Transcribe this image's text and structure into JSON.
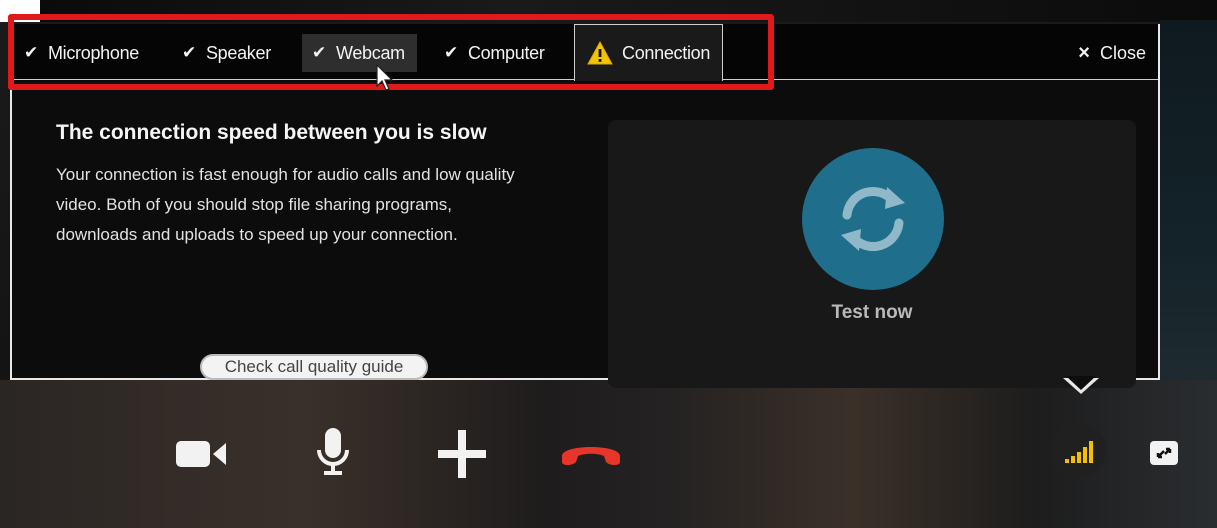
{
  "tabs": [
    {
      "label": "Microphone",
      "state": "check"
    },
    {
      "label": "Speaker",
      "state": "check"
    },
    {
      "label": "Webcam",
      "state": "check"
    },
    {
      "label": "Computer",
      "state": "check"
    },
    {
      "label": "Connection",
      "state": "warning"
    }
  ],
  "close_label": "Close",
  "connection": {
    "headline": "The connection speed between you is slow",
    "body": "Your connection is fast enough for audio calls and low quality video. Both of you should stop file sharing programs, downloads and uploads to speed up your connection.",
    "guide_link": "Check call quality guide"
  },
  "test": {
    "label": "Test now"
  },
  "call_controls": [
    "video-camera-icon",
    "microphone-icon",
    "add-icon",
    "end-call-icon",
    "signal-strength-icon",
    "expand-icon"
  ],
  "colors": {
    "highlight": "#e01a1a",
    "test_button": "#1f6e8c",
    "end_call": "#e8352a",
    "signal": "#f2c200",
    "warning": "#f5c400"
  }
}
